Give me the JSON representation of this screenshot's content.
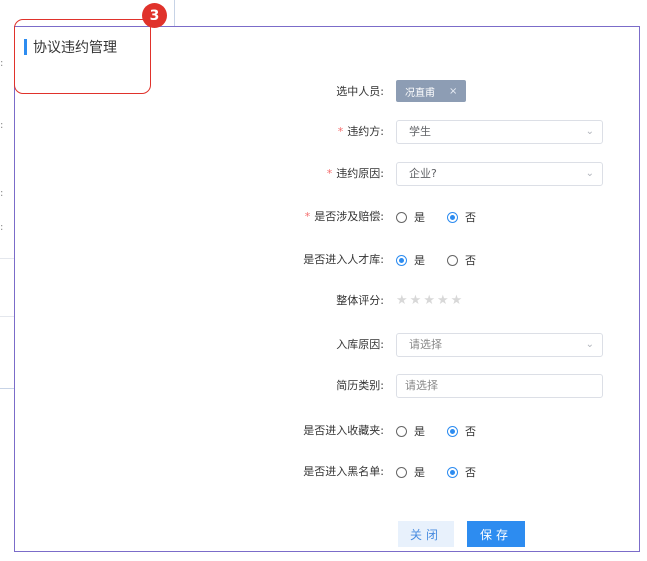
{
  "dialog": {
    "title": "协议违约管理",
    "step_badge": "3"
  },
  "background_fragments": [
    ":",
    ":",
    ":",
    ":"
  ],
  "form": {
    "selected_person": {
      "label": "选中人员:",
      "tag": "况直甫",
      "remove": "×"
    },
    "breach_party": {
      "label": "违约方:",
      "required": "*",
      "value": "学生"
    },
    "breach_reason": {
      "label": "违约原因:",
      "required": "*",
      "value": "企业?"
    },
    "compensation": {
      "label": "是否涉及赔偿:",
      "required": "*",
      "options": [
        "是",
        "否"
      ],
      "selected": "否"
    },
    "talent_pool": {
      "label": "是否进入人才库:",
      "options": [
        "是",
        "否"
      ],
      "selected": "是"
    },
    "rating": {
      "label": "整体评分:",
      "max": 5,
      "value": 0
    },
    "pool_reason": {
      "label": "入库原因:",
      "placeholder": "请选择"
    },
    "resume_type": {
      "label": "简历类别:",
      "placeholder": "请选择"
    },
    "favorites": {
      "label": "是否进入收藏夹:",
      "options": [
        "是",
        "否"
      ],
      "selected": "否"
    },
    "blacklist": {
      "label": "是否进入黑名单:",
      "options": [
        "是",
        "否"
      ],
      "selected": "否"
    }
  },
  "buttons": {
    "close": "关闭",
    "save": "保存"
  },
  "icons": {
    "caret": "chevron-down-icon",
    "star": "star-icon"
  },
  "colors": {
    "primary": "#2d8cf0",
    "highlight": "#e0322b",
    "required": "#f56c6c"
  }
}
